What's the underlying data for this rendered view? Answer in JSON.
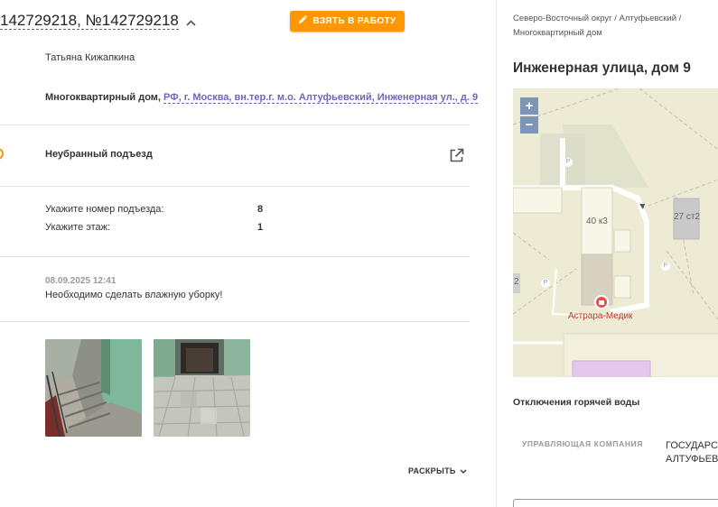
{
  "ticket": {
    "title": "142729218, №142729218",
    "take_button_label": "ВЗЯТЬ В РАБОТУ",
    "applicant_name": "Татьяна Кижапкина",
    "object_type": "Многоквартирный дом,",
    "address_link": "РФ, г. Москва, вн.тер.г. м.о. Алтуфьевский, Инженерная ул., д. 9",
    "category": "Неубранный подъезд",
    "fields": [
      {
        "label": "Укажите номер подъезда:",
        "value": "8"
      },
      {
        "label": "Укажите этаж:",
        "value": "1"
      }
    ],
    "comment_date": "08.09.2025 12:41",
    "comment_text": "Необходимо сделать влажную уборку!",
    "expand_label": "РАСКРЫТЬ"
  },
  "panel": {
    "breadcrumbs": "Северо-Восточный округ / Алтуфьевский / Многоквартирный дом",
    "address_title": "Инженерная улица, дом 9",
    "map": {
      "zoom_in": "+",
      "zoom_out": "−",
      "building_1": "40 к3",
      "building_2": "27 ст2",
      "building_3": "2",
      "poi_name": "Астрара-Медик",
      "parking": "P"
    },
    "hot_water_title": "Отключения горячей воды",
    "management_label": "УПРАВЛЯЮЩАЯ КОМПАНИЯ",
    "management_value_line1": "ГОСУДАРСТ",
    "management_value_line2": "АЛТУФЬЕВО"
  },
  "colors": {
    "accent": "#ff9800",
    "link": "#6a68b8",
    "map_zoom": "#7c94b8"
  }
}
